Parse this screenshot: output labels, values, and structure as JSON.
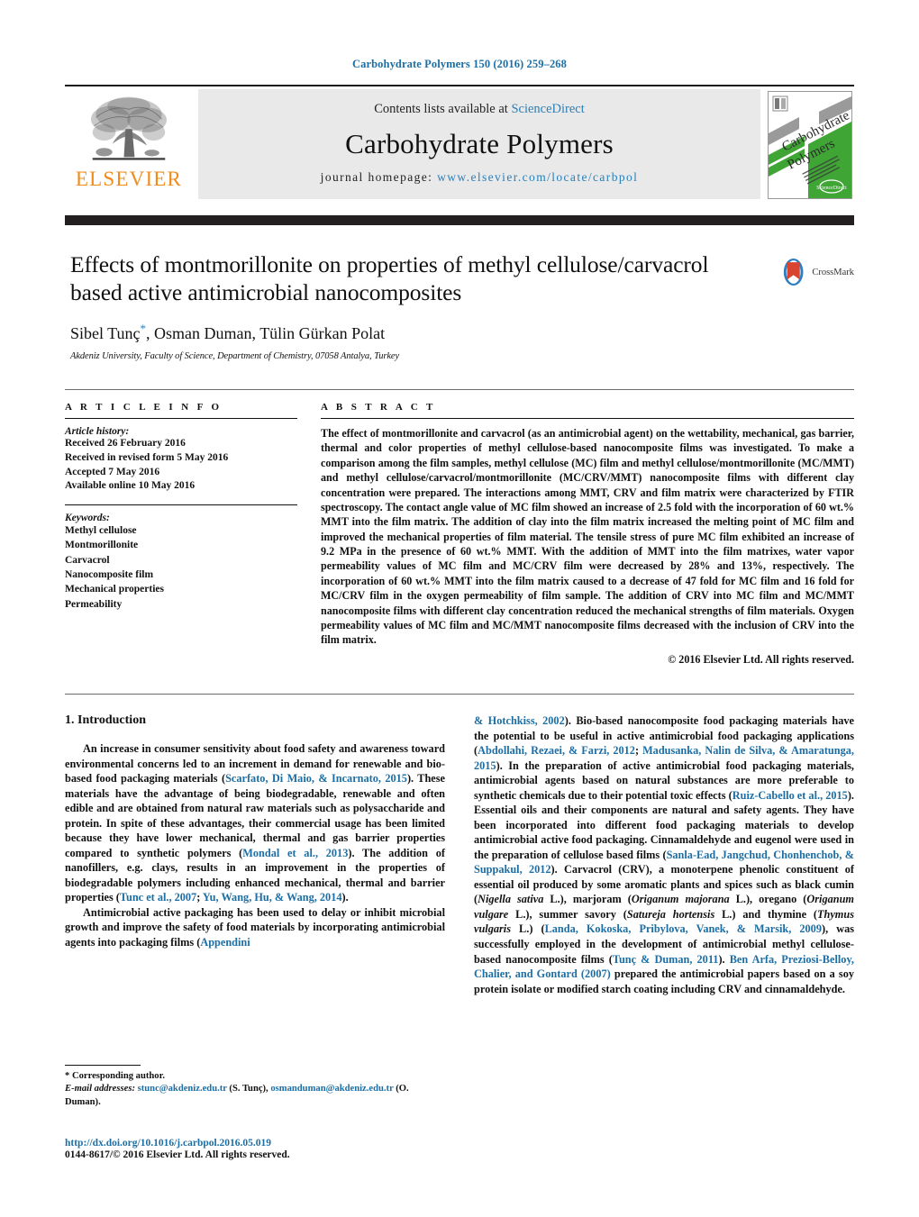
{
  "running_head": "Carbohydrate Polymers 150 (2016) 259–268",
  "masthead": {
    "publisher_name": "ELSEVIER",
    "contents_prefix": "Contents lists available at ",
    "contents_link": "ScienceDirect",
    "journal_title": "Carbohydrate Polymers",
    "homepage_prefix": "journal homepage: ",
    "homepage_url": "www.elsevier.com/locate/carbpol",
    "cover_title_line1": "Carbohydrate",
    "cover_title_line2": "Polymers"
  },
  "article": {
    "title": "Effects of montmorillonite on properties of methyl cellulose/carvacrol based active antimicrobial nanocomposites",
    "authors": "Sibel Tunç",
    "authors_rest": ", Osman Duman, Tülin Gürkan Polat",
    "corresponding_marker": "*",
    "affiliation": "Akdeniz University, Faculty of Science, Department of Chemistry, 07058 Antalya, Turkey",
    "crossmark_label": "CrossMark"
  },
  "article_info": {
    "heading": "A R T I C L E   I N F O",
    "history_label": "Article history:",
    "history": [
      "Received 26 February 2016",
      "Received in revised form 5 May 2016",
      "Accepted 7 May 2016",
      "Available online 10 May 2016"
    ],
    "keywords_label": "Keywords:",
    "keywords": [
      "Methyl cellulose",
      "Montmorillonite",
      "Carvacrol",
      "Nanocomposite film",
      "Mechanical properties",
      "Permeability"
    ]
  },
  "abstract": {
    "heading": "A B S T R A C T",
    "text": "The effect of montmorillonite and carvacrol (as an antimicrobial agent) on the wettability, mechanical, gas barrier, thermal and color properties of methyl cellulose-based nanocomposite films was investigated. To make a comparison among the film samples, methyl cellulose (MC) film and methyl cellulose/montmorillonite (MC/MMT) and methyl cellulose/carvacrol/montmorillonite (MC/CRV/MMT) nanocomposite films with different clay concentration were prepared. The interactions among MMT, CRV and film matrix were characterized by FTIR spectroscopy. The contact angle value of MC film showed an increase of 2.5 fold with the incorporation of 60 wt.% MMT into the film matrix. The addition of clay into the film matrix increased the melting point of MC film and improved the mechanical properties of film material. The tensile stress of pure MC film exhibited an increase of 9.2 MPa in the presence of 60 wt.% MMT. With the addition of MMT into the film matrixes, water vapor permeability values of MC film and MC/CRV film were decreased by 28% and 13%, respectively. The incorporation of 60 wt.% MMT into the film matrix caused to a decrease of 47 fold for MC film and 16 fold for MC/CRV film in the oxygen permeability of film sample. The addition of CRV into MC film and MC/MMT nanocomposite films with different clay concentration reduced the mechanical strengths of film materials. Oxygen permeability values of MC film and MC/MMT nanocomposite films decreased with the inclusion of CRV into the film matrix.",
    "copyright": "© 2016 Elsevier Ltd. All rights reserved."
  },
  "introduction": {
    "heading": "1.  Introduction",
    "left_paragraphs": [
      {
        "segments": [
          {
            "t": "An increase in consumer sensitivity about food safety and awareness toward environmental concerns led to an increment in demand for renewable and bio-based food packaging materials (",
            "k": "plain"
          },
          {
            "t": "Scarfato, Di Maio, & Incarnato, 2015",
            "k": "ref"
          },
          {
            "t": "). These materials have the advantage of being biodegradable, renewable and often edible and are obtained from natural raw materials such as polysaccharide and protein. In spite of these advantages, their commercial usage has been limited because they have lower mechanical, thermal and gas barrier properties compared to synthetic polymers (",
            "k": "plain"
          },
          {
            "t": "Mondal et al., 2013",
            "k": "ref"
          },
          {
            "t": "). The addition of nanofillers, e.g. clays, results in an improvement in the properties of biodegradable polymers including enhanced mechanical, thermal and barrier properties (",
            "k": "plain"
          },
          {
            "t": "Tunc et al., 2007",
            "k": "ref"
          },
          {
            "t": "; ",
            "k": "plain"
          },
          {
            "t": "Yu, Wang, Hu, & Wang, 2014",
            "k": "ref"
          },
          {
            "t": ").",
            "k": "plain"
          }
        ]
      },
      {
        "segments": [
          {
            "t": "Antimicrobial active packaging has been used to delay or inhibit microbial growth and improve the safety of food materials by incorporating antimicrobial agents into packaging films (",
            "k": "plain"
          },
          {
            "t": "Appendini",
            "k": "ref"
          }
        ]
      }
    ],
    "right_paragraphs": [
      {
        "segments": [
          {
            "t": "& Hotchkiss, 2002",
            "k": "ref"
          },
          {
            "t": "). Bio-based nanocomposite food packaging materials have the potential to be useful in active antimicrobial food packaging applications (",
            "k": "plain"
          },
          {
            "t": "Abdollahi, Rezaei, & Farzi, 2012",
            "k": "ref"
          },
          {
            "t": "; ",
            "k": "plain"
          },
          {
            "t": "Madusanka, Nalin de Silva, & Amaratunga, 2015",
            "k": "ref"
          },
          {
            "t": "). In the preparation of active antimicrobial food packaging materials, antimicrobial agents based on natural substances are more preferable to synthetic chemicals due to their potential toxic effects (",
            "k": "plain"
          },
          {
            "t": "Ruiz-Cabello et al., 2015",
            "k": "ref"
          },
          {
            "t": "). Essential oils and their components are natural and safety agents. They have been incorporated into different food packaging materials to develop antimicrobial active food packaging. Cinnamaldehyde and eugenol were used in the preparation of cellulose based films (",
            "k": "plain"
          },
          {
            "t": "Sanla-Ead, Jangchud, Chonhenchob, & Suppakul, 2012",
            "k": "ref"
          },
          {
            "t": "). Carvacrol (CRV), a monoterpene phenolic constituent of essential oil produced by some aromatic plants and spices such as black cumin (",
            "k": "plain"
          },
          {
            "t": "Nigella sativa",
            "k": "ital"
          },
          {
            "t": " L.), marjoram (",
            "k": "plain"
          },
          {
            "t": "Origanum majorana",
            "k": "ital"
          },
          {
            "t": " L.), oregano (",
            "k": "plain"
          },
          {
            "t": "Origanum vulgare",
            "k": "ital"
          },
          {
            "t": " L.), summer savory (",
            "k": "plain"
          },
          {
            "t": "Satureja hortensis",
            "k": "ital"
          },
          {
            "t": " L.) and thymine (",
            "k": "plain"
          },
          {
            "t": "Thymus vulgaris",
            "k": "ital"
          },
          {
            "t": " L.) (",
            "k": "plain"
          },
          {
            "t": "Landa, Kokoska, Pribylova, Vanek, & Marsik, 2009",
            "k": "ref"
          },
          {
            "t": "), was successfully employed in the development of antimicrobial methyl cellulose-based nanocomposite films (",
            "k": "plain"
          },
          {
            "t": "Tunç & Duman, 2011",
            "k": "ref"
          },
          {
            "t": "). ",
            "k": "plain"
          },
          {
            "t": "Ben Arfa, Preziosi-Belloy, Chalier, and Gontard (2007)",
            "k": "ref"
          },
          {
            "t": " prepared the antimicrobial papers based on a soy protein isolate or modified starch coating including CRV and cinnamaldehyde.",
            "k": "plain"
          }
        ]
      }
    ]
  },
  "footnote": {
    "corresponding": "*  Corresponding author.",
    "email_label": "E-mail addresses:",
    "email1": "stunc@akdeniz.edu.tr",
    "email1_owner": " (S. Tunç), ",
    "email2": "osmanduman@akdeniz.edu.tr",
    "email2_owner": "(O. Duman)."
  },
  "doi": {
    "url": "http://dx.doi.org/10.1016/j.carbpol.2016.05.019",
    "issn": "0144-8617/© 2016 Elsevier Ltd. All rights reserved."
  },
  "colors": {
    "link_blue": "#1c6ea4",
    "accent_blue": "#2a7fb8",
    "elsevier_orange": "#f08c1b",
    "dark_band": "#231f20",
    "box_grey": "#e9e9e9",
    "cover_green": "#3fa535"
  }
}
